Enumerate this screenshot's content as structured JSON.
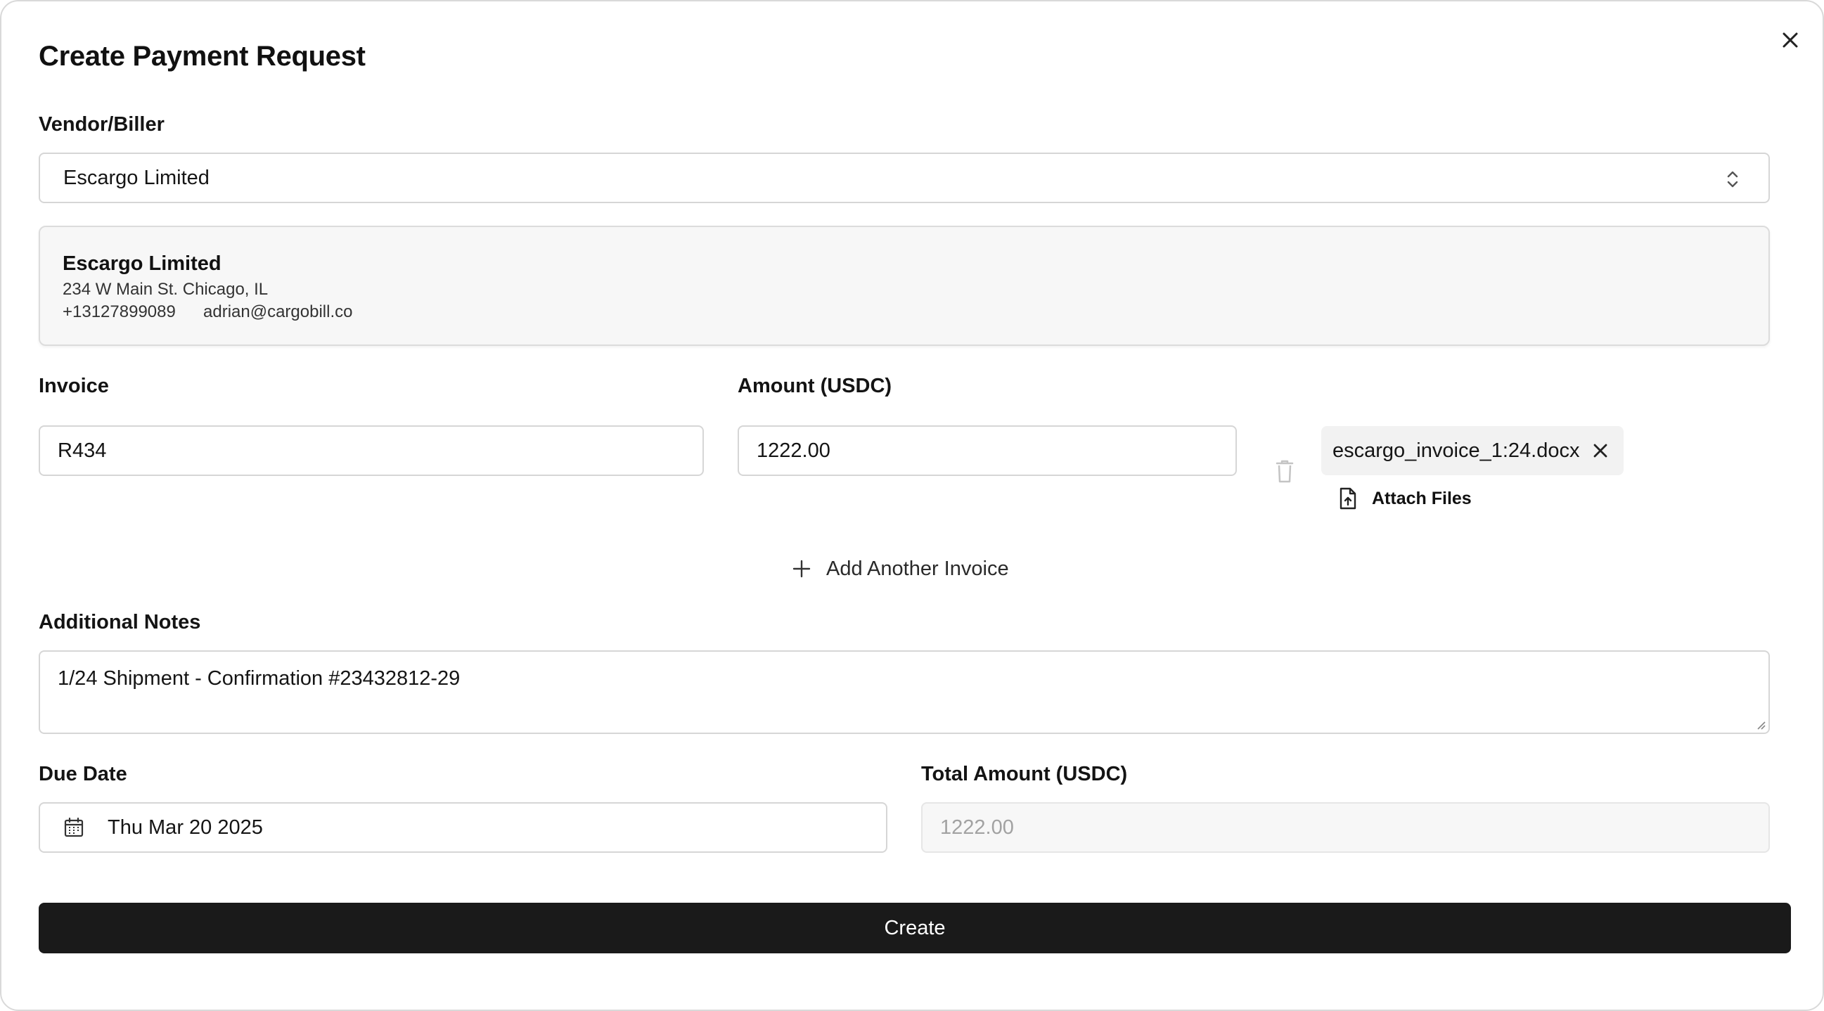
{
  "dialog": {
    "title": "Create Payment Request",
    "close_icon": "close-icon"
  },
  "vendor": {
    "label": "Vendor/Biller",
    "selected": "Escargo Limited",
    "select_icon": "chevron-up-down-icon",
    "card": {
      "name": "Escargo Limited",
      "address": "234 W Main St. Chicago, IL",
      "phone": "+13127899089",
      "email": "adrian@cargobill.co"
    }
  },
  "invoice": {
    "label": "Invoice",
    "value": "R434",
    "amount_label": "Amount (USDC)",
    "amount_value": "1222.00",
    "delete_icon": "trash-icon",
    "attachment": {
      "filename": "escargo_invoice_1:24.docx",
      "remove_icon": "close-icon"
    },
    "attach_files_label": "Attach Files",
    "attach_icon": "file-upload-icon"
  },
  "add_invoice_label": "Add Another Invoice",
  "notes": {
    "label": "Additional Notes",
    "value": "1/24 Shipment - Confirmation #23432812-29"
  },
  "due_date": {
    "label": "Due Date",
    "value": "Thu Mar 20 2025",
    "icon": "calendar-icon"
  },
  "total": {
    "label": "Total Amount (USDC)",
    "value": "1222.00"
  },
  "create_button_label": "Create",
  "colors": {
    "primary_button": "#1a1a1a",
    "border": "#d6d6d6",
    "card_background": "#f7f7f7"
  }
}
